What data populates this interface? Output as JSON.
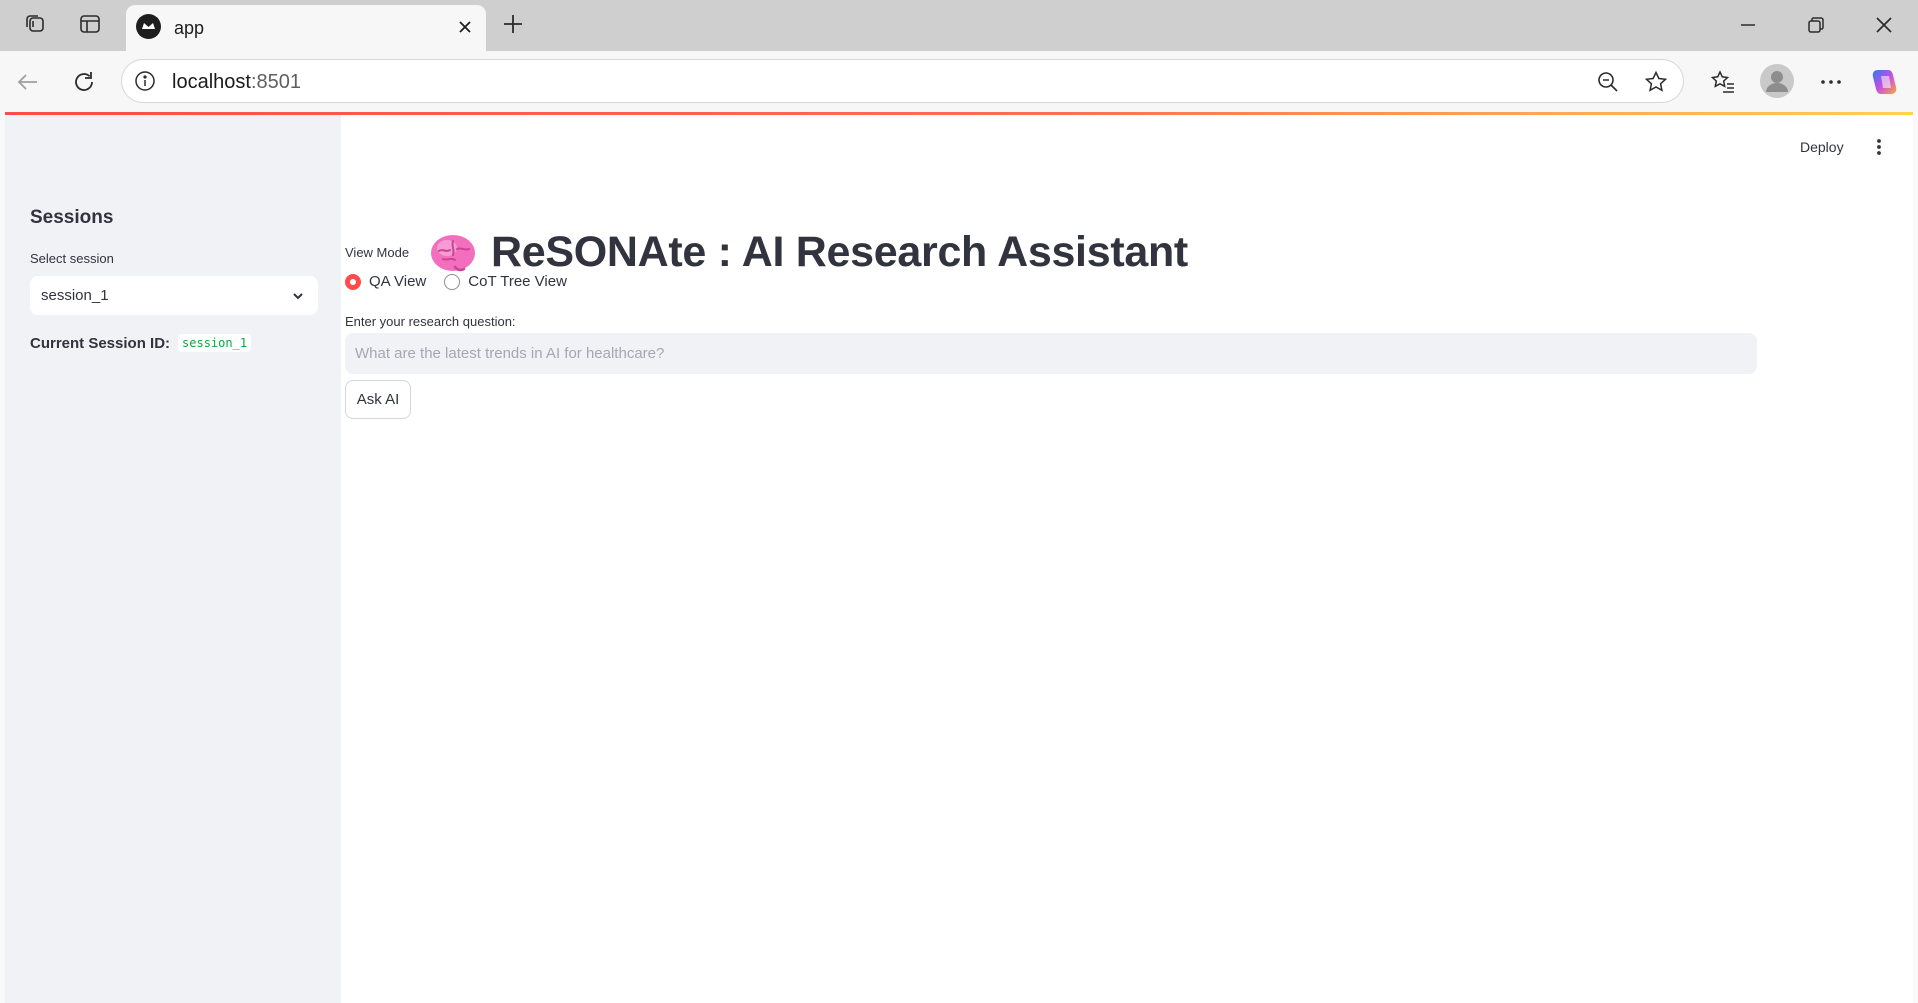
{
  "browser": {
    "tab_title": "app",
    "url_host": "localhost",
    "url_port": ":8501"
  },
  "app": {
    "deploy_label": "Deploy",
    "title": "ReSONAte : AI Research Assistant",
    "title_icon": "brain-emoji",
    "accent_color": "#ff4b4b"
  },
  "sidebar": {
    "heading": "Sessions",
    "select_label": "Select session",
    "selected_session": "session_1",
    "current_label": "Current Session ID:",
    "current_value": "session_1"
  },
  "main": {
    "view_mode_label": "View Mode",
    "view_options": [
      "QA View",
      "CoT Tree View"
    ],
    "selected_view": "QA View",
    "question_label": "Enter your research question:",
    "question_placeholder": "What are the latest trends in AI for healthcare?",
    "question_value": "",
    "ask_button": "Ask AI"
  }
}
